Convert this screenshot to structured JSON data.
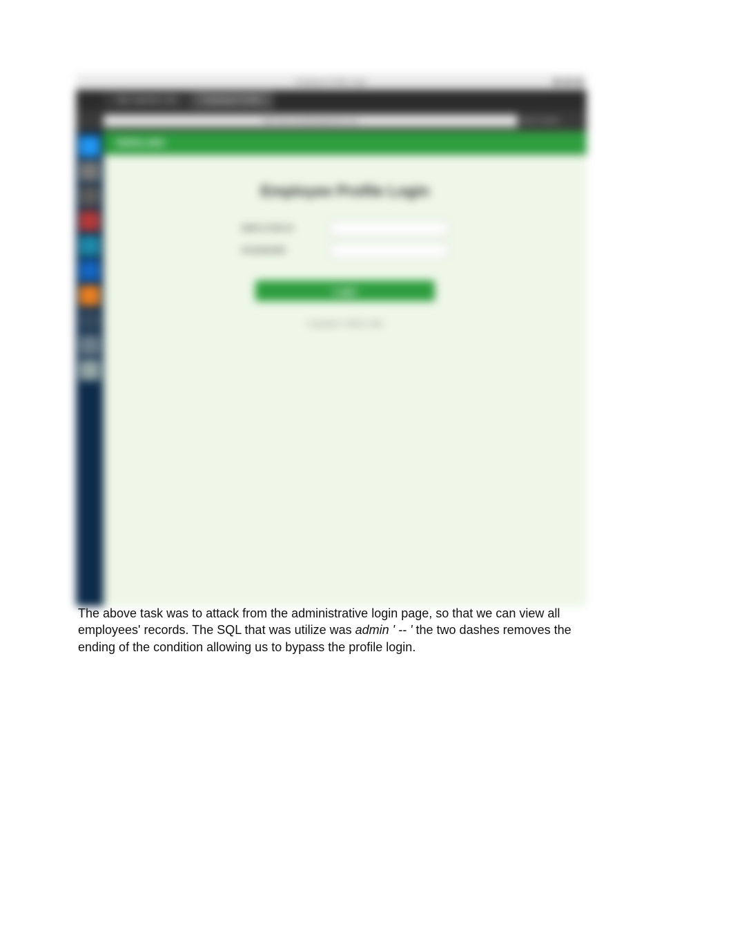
{
  "browser": {
    "window_title": "Employee Profile Login",
    "tabs": [
      {
        "label": "SQL Injection Lab"
      },
      {
        "label": "Employee Profile"
      }
    ],
    "address": "http://www.seedlabsqlinjection.com",
    "right_label": "Most Visited"
  },
  "sidebar": {
    "items": [
      {
        "name": "home"
      },
      {
        "name": "files"
      },
      {
        "name": "edit"
      },
      {
        "name": "terminal"
      },
      {
        "name": "network"
      },
      {
        "name": "browser"
      },
      {
        "name": "firefox"
      },
      {
        "name": "settings"
      },
      {
        "name": "monitor"
      },
      {
        "name": "trash"
      }
    ]
  },
  "page": {
    "header_brand": "SEEDLABS",
    "login_title": "Employee Profile Login",
    "id_label": "EMPLOYEE ID",
    "password_label": "PASSWORD",
    "id_value": "",
    "password_value": "",
    "login_button": "Login",
    "copyright": "Copyright © SEED LABs"
  },
  "caption": {
    "line1_a": "The above task was to attack from the administrative login page, so that we can view all ",
    "line2_a": "employees' records. The SQL that was utilize was ",
    "line2_italic": "admin ' -- '",
    "line2_b": " the two dashes removes the ",
    "line3": "ending of the condition allowing us to bypass the profile login."
  }
}
